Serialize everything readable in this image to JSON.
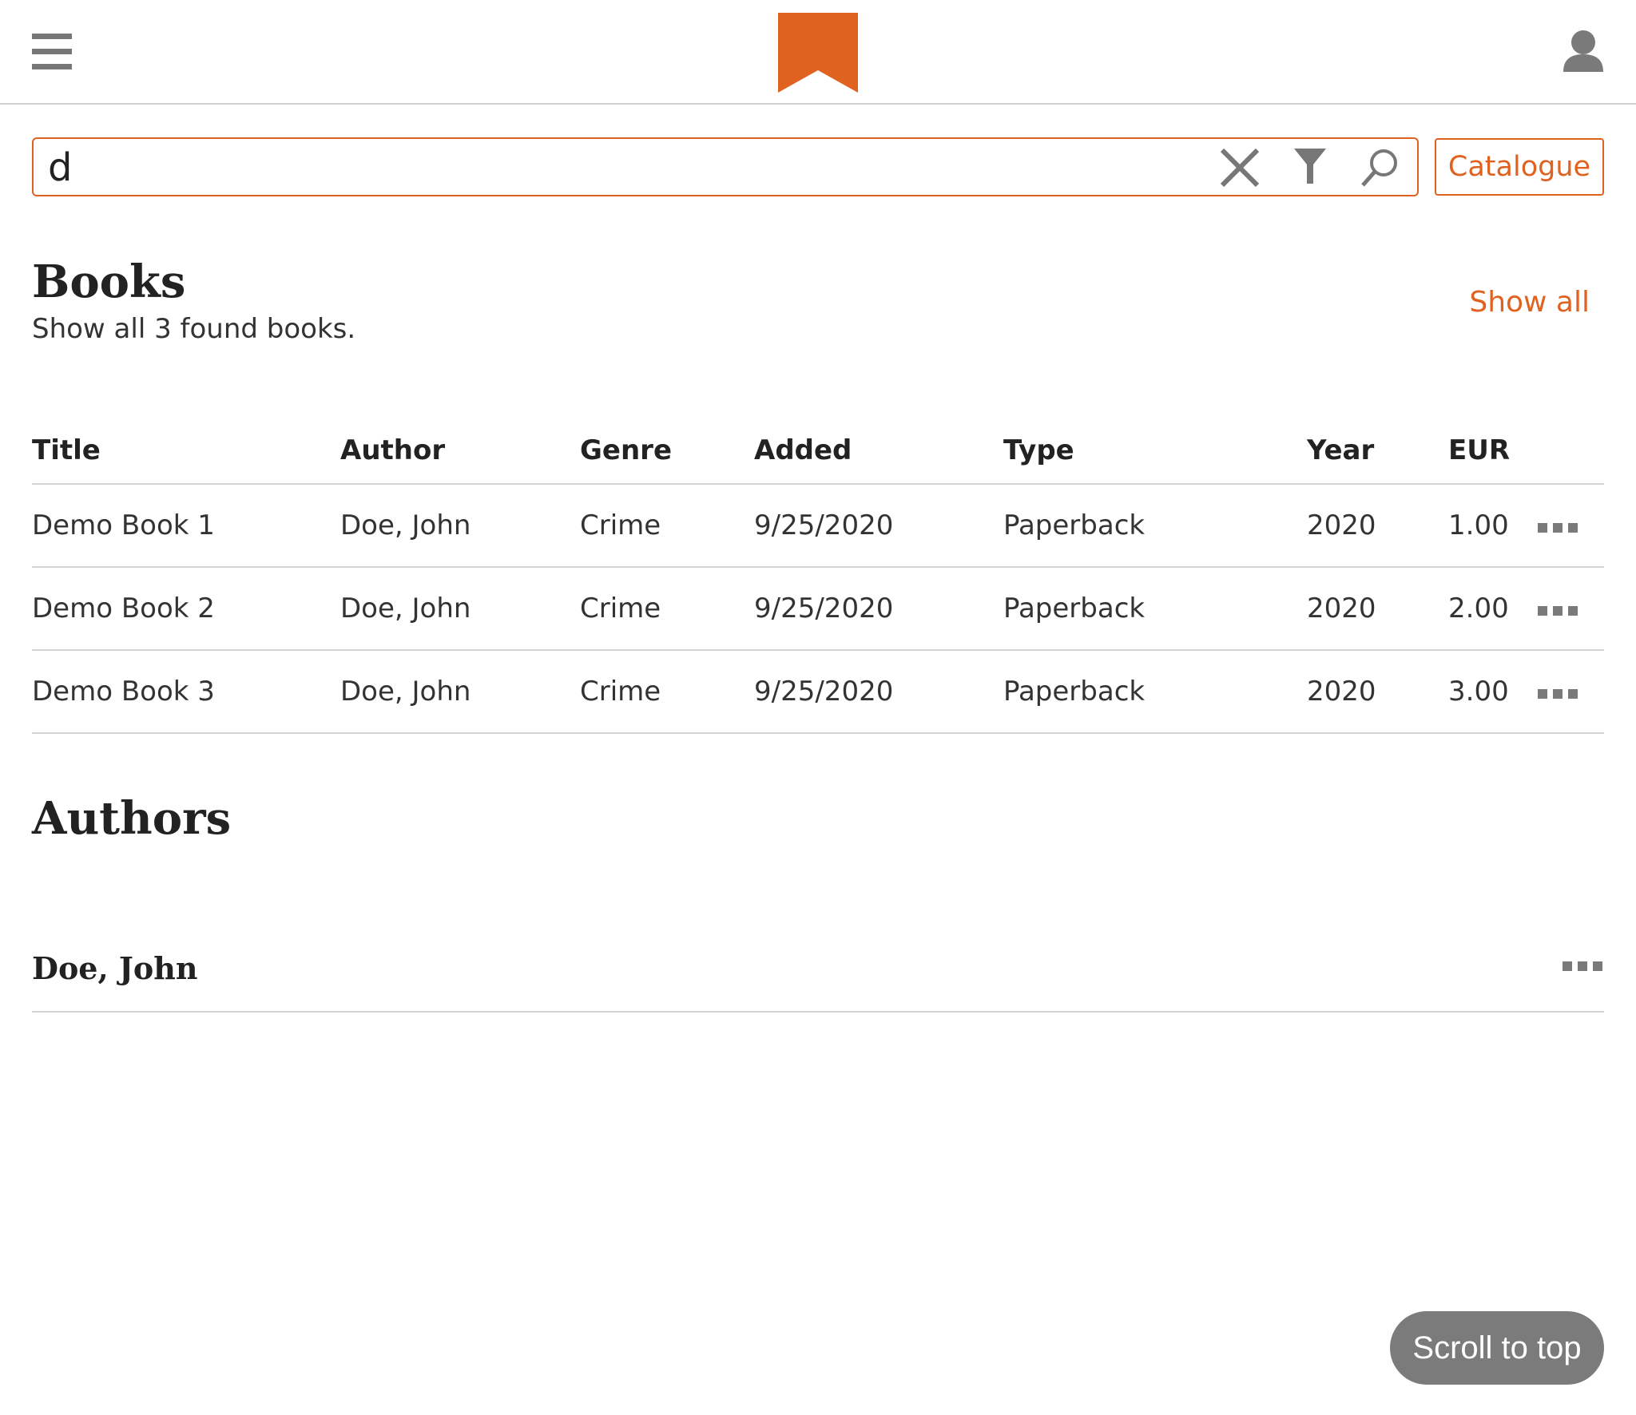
{
  "header": {
    "menu_icon": "hamburger-menu-icon",
    "logo_icon": "bookmark-logo",
    "user_icon": "user-icon",
    "brand_color": "#e06220"
  },
  "search": {
    "value": "d",
    "placeholder": "",
    "clear_icon": "close-icon",
    "filter_icon": "filter-icon",
    "search_icon": "search-icon",
    "catalogue_label": "Catalogue"
  },
  "books": {
    "title": "Books",
    "subtitle": "Show all 3 found books.",
    "show_all_label": "Show all",
    "columns": [
      "Title",
      "Author",
      "Genre",
      "Added",
      "Type",
      "Year",
      "EUR"
    ],
    "rows": [
      {
        "title": "Demo Book 1",
        "author": "Doe, John",
        "genre": "Crime",
        "added": "9/25/2020",
        "type": "Paperback",
        "year": "2020",
        "eur": "1.00"
      },
      {
        "title": "Demo Book 2",
        "author": "Doe, John",
        "genre": "Crime",
        "added": "9/25/2020",
        "type": "Paperback",
        "year": "2020",
        "eur": "2.00"
      },
      {
        "title": "Demo Book 3",
        "author": "Doe, John",
        "genre": "Crime",
        "added": "9/25/2020",
        "type": "Paperback",
        "year": "2020",
        "eur": "3.00"
      }
    ],
    "row_menu_icon": "more-dots-icon"
  },
  "authors": {
    "title": "Authors",
    "items": [
      {
        "name": "Doe, John"
      }
    ]
  },
  "scroll_top_label": "Scroll to top"
}
